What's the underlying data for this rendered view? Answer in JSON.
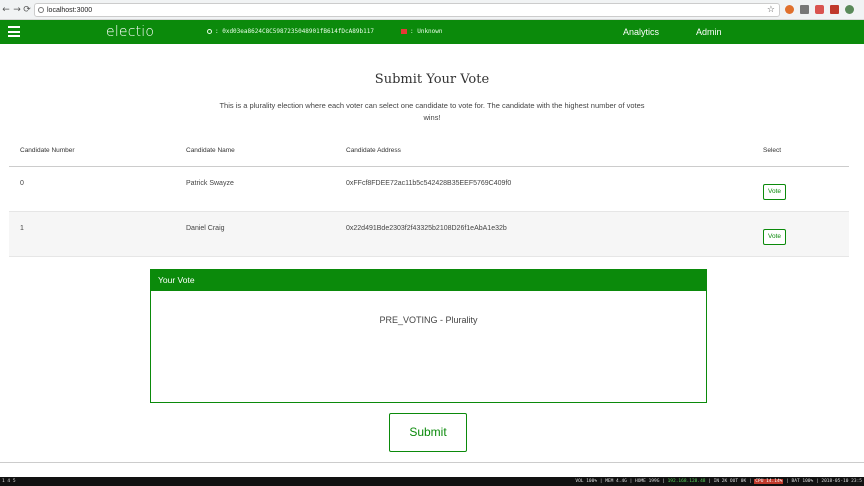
{
  "browser": {
    "url": "localhost:3000",
    "back": "←",
    "forward": "→",
    "reload": "⟳",
    "star": "☆",
    "extension_icons": [
      "brave-icon",
      "chat-icon",
      "extension-icon",
      "shield-icon",
      "profile-icon"
    ]
  },
  "header": {
    "brand": "electio",
    "account_address": ": 0xd03ea8624C8C5987235048901fB614fDcA89b117",
    "network_status": ": Unknown",
    "nav": [
      "Analytics",
      "Admin"
    ]
  },
  "main": {
    "title": "Submit Your Vote",
    "description": "This is a plurality election where each voter can select one candidate to vote for. The candidate with the highest number of votes wins!",
    "table": {
      "headers": [
        "Candidate Number",
        "Candidate Name",
        "Candidate Address",
        "Select"
      ],
      "rows": [
        {
          "number": "0",
          "name": "Patrick Swayze",
          "address": "0xFFcf8FDEE72ac11b5c542428B35EEF5769C409f0",
          "action": "Vote"
        },
        {
          "number": "1",
          "name": "Daniel Craig",
          "address": "0x22d491Bde2303f2f43325b2108D26f1eAbA1e32b",
          "action": "Vote"
        }
      ]
    },
    "your_vote": {
      "heading": "Your Vote",
      "status": "PRE_VOTING - Plurality"
    },
    "submit_label": "Submit"
  },
  "os_bar": {
    "left": "1 4 5",
    "vol": "VOL 100%",
    "mem": "MEM 4.4G",
    "home": "HOME 199G",
    "ip": "192.168.128.48",
    "net": "IN 2K OUT 0K",
    "cpu": "CPU 14.14%",
    "bat": "BAT 100%",
    "datetime": "2018-05-10 23:5"
  },
  "colors": {
    "primary_green": "#0b8a0b",
    "header_text": "#ffffff"
  }
}
